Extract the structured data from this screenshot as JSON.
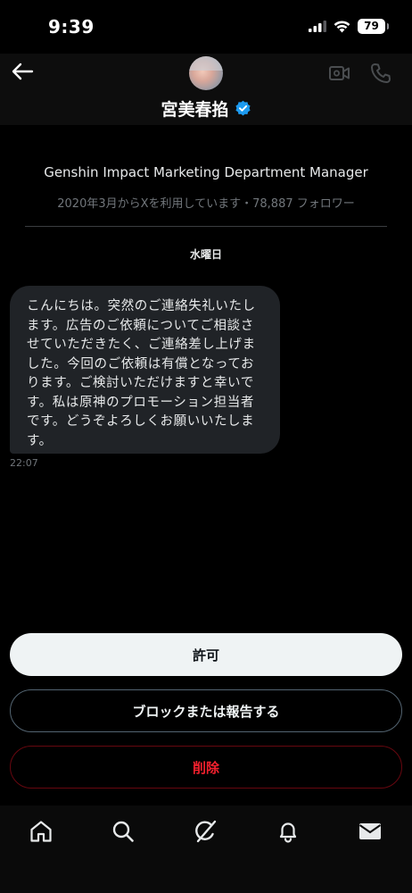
{
  "status_bar": {
    "time": "9:39",
    "battery": "79"
  },
  "header": {
    "display_name": "宮美春掐",
    "verified": true,
    "back_icon": "arrow-left-icon",
    "video_icon": "video-camera-icon",
    "call_icon": "phone-icon"
  },
  "profile": {
    "bio": "Genshin Impact Marketing Department Manager",
    "meta": "2020年3月からXを利用しています・78,887 フォロワー"
  },
  "conversation": {
    "day_label": "水曜日",
    "messages": [
      {
        "text": "こんにちは。突然のご連絡失礼いたします。広告のご依頼についてご相談させていただきたく、ご連絡差し上げました。今回のご依頼は有償となっております。ご検討いただけますと幸いです。私は原神のプロモーション担当者です。どうぞよろしくお願いいたします。",
        "time": "22:07"
      }
    ]
  },
  "actions": {
    "allow": "許可",
    "block_report": "ブロックまたは報告する",
    "delete": "削除"
  },
  "tabbar": [
    "home-icon",
    "search-icon",
    "grok-icon",
    "bell-icon",
    "mail-icon"
  ],
  "colors": {
    "background": "#000000",
    "bubble": "#202327",
    "accent": "#1d9bf0",
    "danger": "#f4212e",
    "muted": "#71767b"
  }
}
